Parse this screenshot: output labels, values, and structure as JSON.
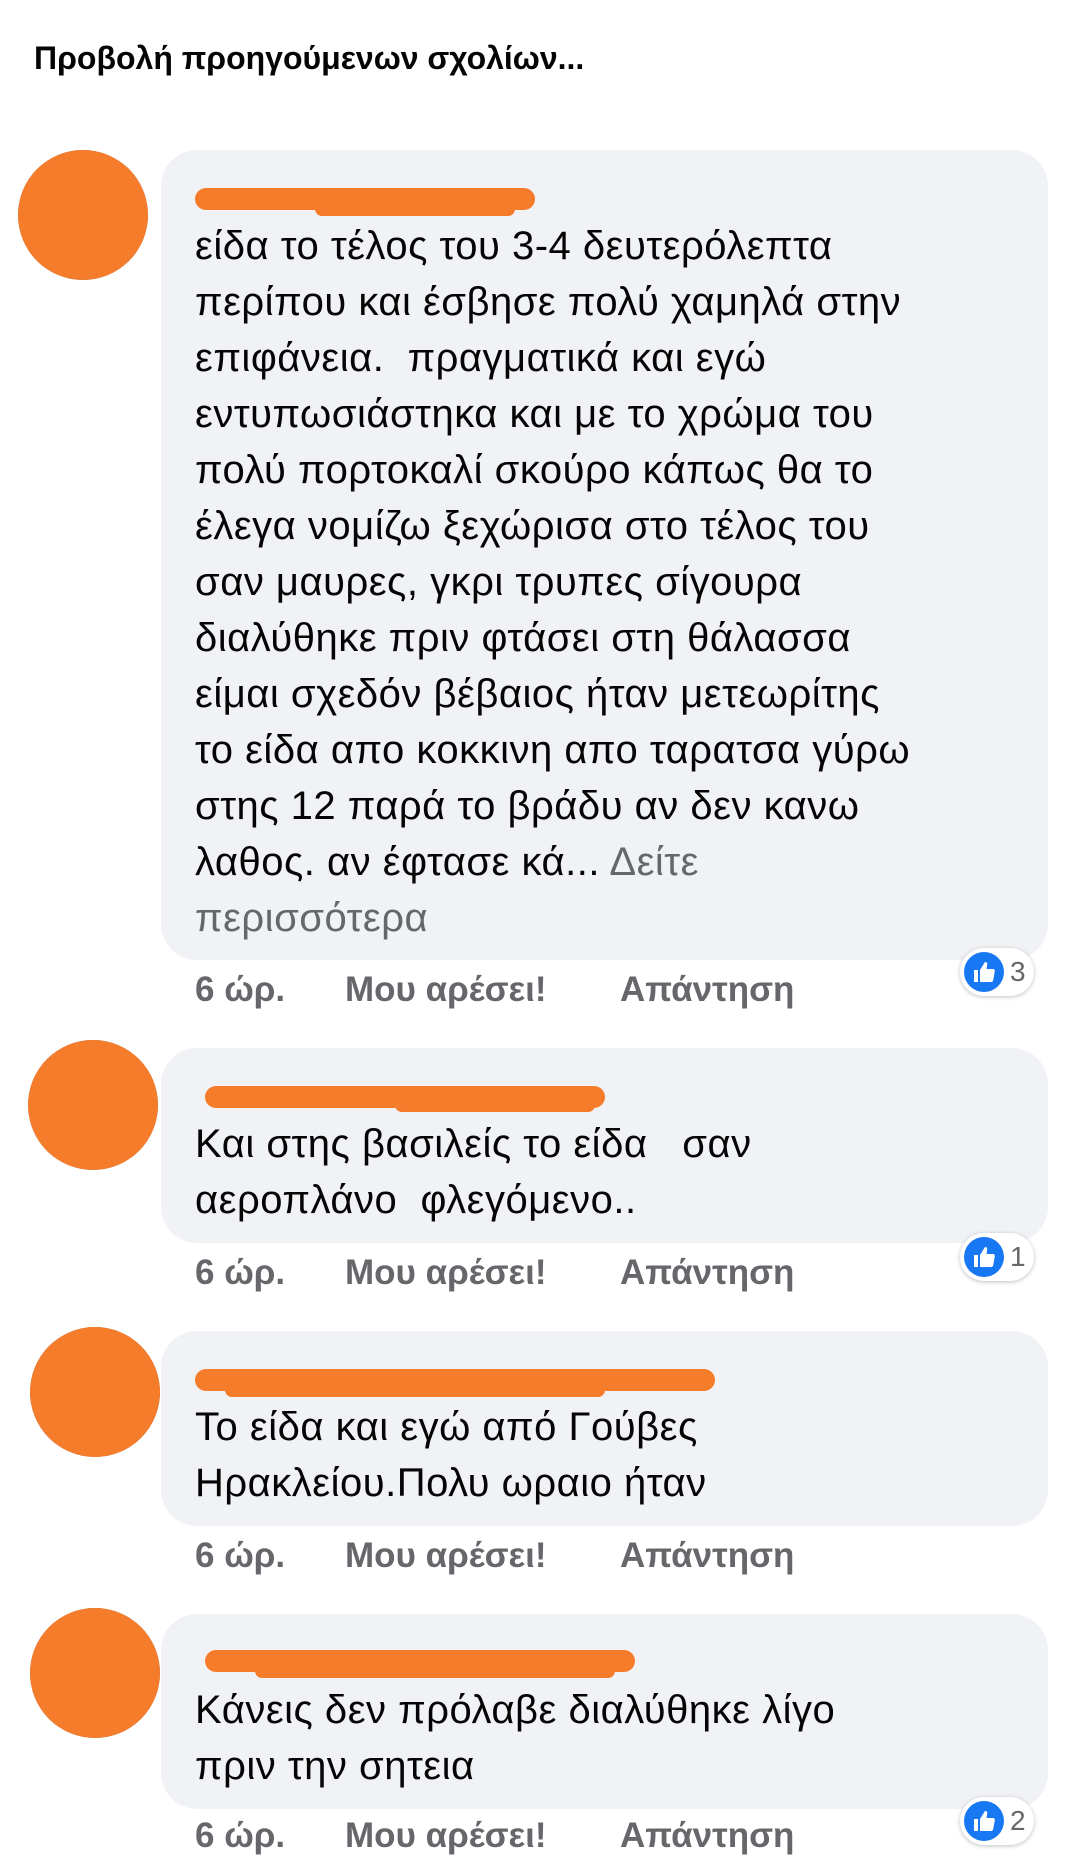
{
  "prev_comments_link": "Προβολή προηγούμενων σχολίων...",
  "comments": [
    {
      "text": "είδα το τέλος του 3-4 δευτερόλεπτα\nπερίπου και έσβησε πολύ χαμηλά στην\nεπιφάνεια.  πραγματικά και εγώ\nεντυπωσιάστηκα και με το χρώμα του\nπολύ πορτοκαλί σκούρο κάπως θα το\nέλεγα νομίζω ξεχώρισα στο τέλος του\nσαν μαυρες, γκρι τρυπες σίγουρα\nδιαλύθηκε πριν φτάσει στη θάλασσα\nείμαι σχεδόν βέβαιος ήταν μετεωρίτης\nτο είδα απο κοκκινη απο ταρατσα γύρω\nστης 12 παρά το βράδυ αν δεν κανω\nλαθος. αν έφτασε κά... ",
      "see_more": "Δείτε\nπερισσότερα",
      "time": "6 ώρ.",
      "like_label": "Μου αρέσει!",
      "reply_label": "Απάντηση",
      "reaction_count": "3"
    },
    {
      "text": "Και στης βασιλείς το είδα   σαν\nαεροπλάνο  φλεγόμενο..",
      "time": "6 ώρ.",
      "like_label": "Μου αρέσει!",
      "reply_label": "Απάντηση",
      "reaction_count": "1"
    },
    {
      "text": "Το είδα και εγώ από Γούβες\nΗρακλείου.Πολυ ωραιο ήταν",
      "time": "6 ώρ.",
      "like_label": "Μου αρέσει!",
      "reply_label": "Απάντηση",
      "reaction_count": ""
    },
    {
      "text": "Κάνεις δεν πρόλαβε διαλύθηκε λίγο\nπριν την σητεια",
      "time": "6 ώρ.",
      "like_label": "Μου αρέσει!",
      "reply_label": "Απάντηση",
      "reaction_count": "2"
    }
  ],
  "colors": {
    "bubble": "#f0f2f5",
    "redaction": "#f57c2a",
    "like_blue": "#1877f2",
    "secondary_text": "#65676b"
  }
}
